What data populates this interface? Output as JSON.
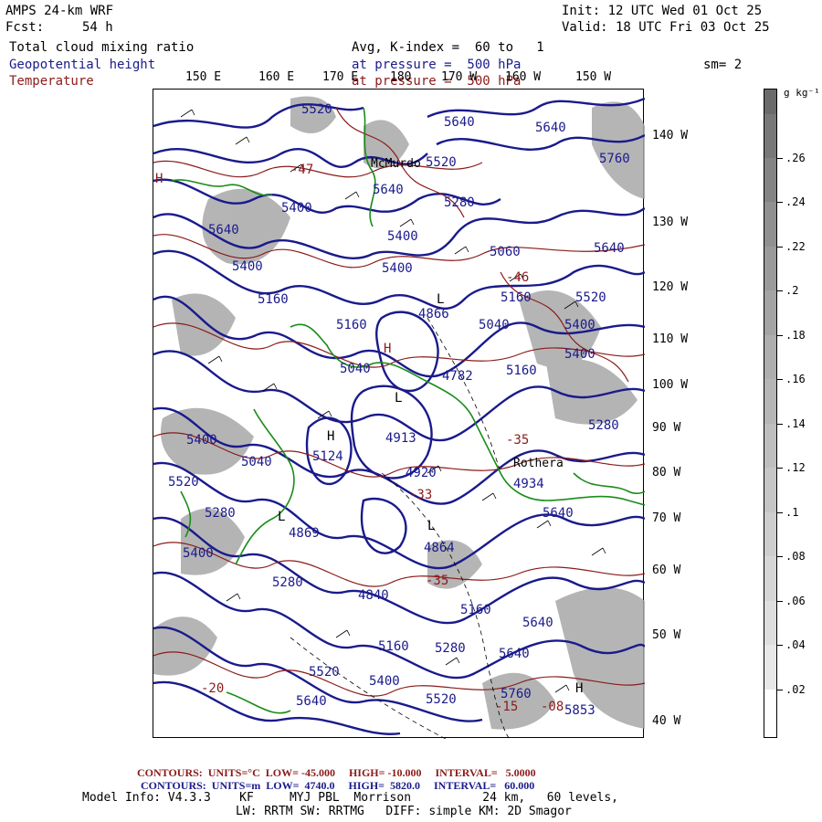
{
  "header": {
    "model": "AMPS 24-km WRF",
    "forecast_label": "Fcst:",
    "forecast_hour": "54 h",
    "init": "Init: 12 UTC Wed 01 Oct 25",
    "valid": "Valid: 18 UTC Fri 03 Oct 25",
    "field_cloud": "Total cloud mixing ratio",
    "field_height": "Geopotential height",
    "field_temp": "Temperature",
    "avg_k": "Avg, K-index =  60 to   1",
    "pressure_height": "at pressure =  500 hPa",
    "pressure_temp": "at pressure =  500 hPa",
    "smoothing": "sm= 2"
  },
  "map": {
    "longitudes_top": [
      "150 E",
      "160 E",
      "170 E",
      "180",
      "170 W",
      "160 W",
      "150 W"
    ],
    "longitudes_right": [
      "140 W",
      "130 W",
      "120 W",
      "110 W",
      "100 W",
      "90 W",
      "80 W",
      "70 W",
      "60 W",
      "50 W",
      "40 W"
    ],
    "height_labels": [
      "5520",
      "5640",
      "5640",
      "5520",
      "5640",
      "5760",
      "5400",
      "5640",
      "5280",
      "5400",
      "5400",
      "5060",
      "5640",
      "5400",
      "5160",
      "5160",
      "4866",
      "5160",
      "5520",
      "5400",
      "5040",
      "5040",
      "4782",
      "5160",
      "5400",
      "5280",
      "5400",
      "5124",
      "4913",
      "5040",
      "4920",
      "4934",
      "5520",
      "5280",
      "5640",
      "4869",
      "4864",
      "5280",
      "4840",
      "5160",
      "5640",
      "5400",
      "5160",
      "5280",
      "5520",
      "5400",
      "5640",
      "5520",
      "5640",
      "5760",
      "5853"
    ],
    "temp_labels": [
      "-47",
      "-46",
      "-35",
      "-33",
      "-35",
      "-20",
      "-15",
      "-08"
    ],
    "place_labels": [
      "McMurdo",
      "Rothera"
    ],
    "high_low_markers": [
      "H",
      "L",
      "H",
      "L",
      "L",
      "H",
      "L",
      "H"
    ],
    "colors": {
      "height": "#1a1a8c",
      "temperature": "#8b1a1a",
      "coast": "#1a8c1a",
      "cloud": "#9a9a9a"
    }
  },
  "colorbar": {
    "units": "g kg⁻¹",
    "labels": [
      ".26",
      ".24",
      ".22",
      ".2",
      ".18",
      ".16",
      ".14",
      ".12",
      ".1",
      ".08",
      ".06",
      ".04",
      ".02"
    ],
    "levels": [
      0.28,
      0.26,
      0.24,
      0.22,
      0.2,
      0.18,
      0.16,
      0.14,
      0.12,
      0.1,
      0.08,
      0.06,
      0.04,
      0.02,
      0
    ]
  },
  "footer": {
    "temp_contours": "CONTOURS:  UNITS=°C  LOW= -45.000     HIGH= -10.000     INTERVAL=   5.0000",
    "height_contours": "CONTOURS:  UNITS=m  LOW=  4740.0     HIGH=  5820.0     INTERVAL=   60.000",
    "model_info": "Model Info: V4.3.3    KF     MYJ PBL  Morrison          24 km,   60 levels,",
    "model_info2": "LW: RRTM SW: RRTMG   DIFF: simple KM: 2D Smagor"
  }
}
